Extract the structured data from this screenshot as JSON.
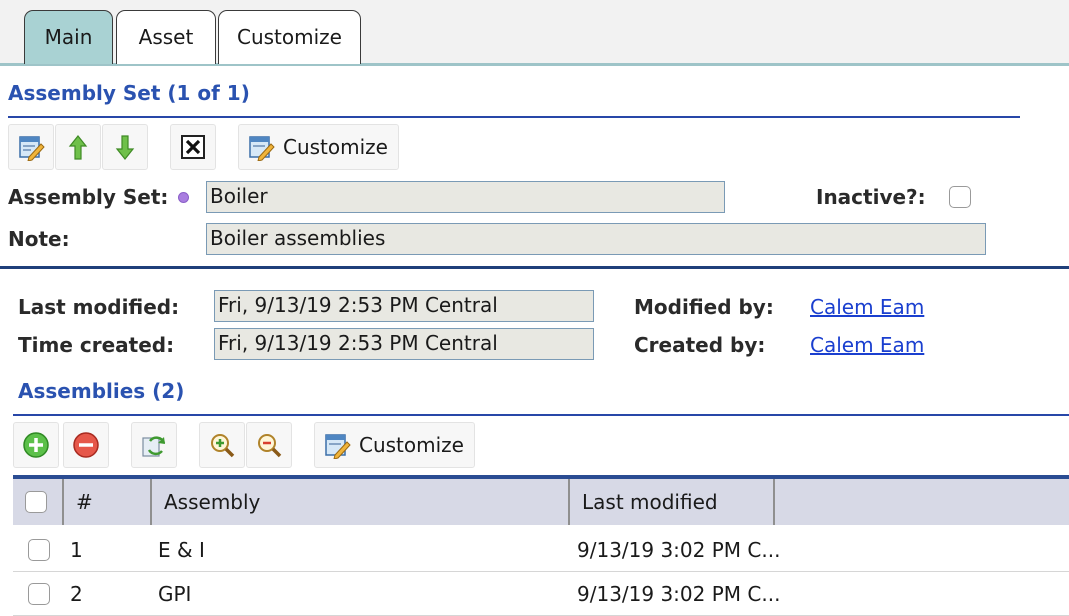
{
  "tabs": [
    {
      "label": "Main",
      "active": true
    },
    {
      "label": "Asset",
      "active": false
    },
    {
      "label": "Customize",
      "active": false
    }
  ],
  "assembly_set_section": {
    "title": "Assembly Set (1 of 1)",
    "toolbar": {
      "edit_icon": "edit-icon",
      "prev_icon": "arrow-up-icon",
      "next_icon": "arrow-down-icon",
      "close_icon": "close-icon",
      "customize_label": "Customize"
    },
    "assembly_set_label": "Assembly Set:",
    "assembly_set_value": "Boiler",
    "inactive_label": "Inactive?:",
    "inactive_checked": false,
    "note_label": "Note:",
    "note_value": "Boiler assemblies"
  },
  "audit": {
    "last_modified_label": "Last modified:",
    "last_modified_value": "Fri, 9/13/19 2:53 PM Central",
    "time_created_label": "Time created:",
    "time_created_value": "Fri, 9/13/19 2:53 PM Central",
    "modified_by_label": "Modified by:",
    "modified_by_value": "Calem Eam",
    "created_by_label": "Created by:",
    "created_by_value": "Calem Eam"
  },
  "assemblies_section": {
    "title": "Assemblies (2)",
    "toolbar": {
      "add_icon": "add-icon",
      "remove_icon": "remove-icon",
      "refresh_icon": "refresh-icon",
      "zoom_in_icon": "zoom-in-icon",
      "zoom_out_icon": "zoom-out-icon",
      "customize_label": "Customize"
    },
    "columns": [
      "#",
      "Assembly",
      "Last modified"
    ],
    "rows": [
      {
        "num": "1",
        "assembly": "E & I",
        "last_modified": "9/13/19 3:02 PM C..."
      },
      {
        "num": "2",
        "assembly": "GPI",
        "last_modified": "9/13/19 3:02 PM C..."
      }
    ]
  },
  "colors": {
    "accent_blue": "#2a52b0",
    "active_tab": "#a9d2d3",
    "link": "#1a3fcf",
    "grid_header": "#d7d9e6"
  }
}
